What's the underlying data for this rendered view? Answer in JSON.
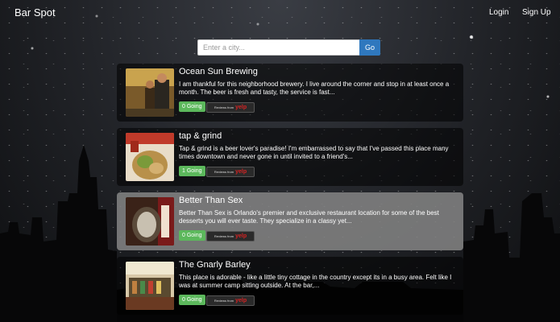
{
  "navbar": {
    "brand": "Bar Spot",
    "login": "Login",
    "signup": "Sign Up"
  },
  "search": {
    "placeholder": "Enter a city...",
    "button": "Go"
  },
  "results": [
    {
      "title": "Ocean Sun Brewing",
      "snippet": "I am thankful for this neighborhood brewery. I live around the corner and stop in at least once a month. The beer is fresh and tasty, the service is fast...",
      "going": "0 Going",
      "reviews_label": "Reviews from",
      "yelp": "yelp"
    },
    {
      "title": "tap & grind",
      "snippet": "Tap & grind is a beer lover's paradise! I'm embarrassed to say that I've passed this place many times downtown and never gone in until invited to a friend's...",
      "going": "1 Going",
      "reviews_label": "Reviews from",
      "yelp": "yelp"
    },
    {
      "title": "Better Than Sex",
      "snippet": "Better Than Sex is Orlando's premier and exclusive restaurant location for some of the best desserts you will ever taste. They specialize in a classy yet...",
      "going": "0 Going",
      "reviews_label": "Reviews from",
      "yelp": "yelp"
    },
    {
      "title": "The Gnarly Barley",
      "snippet": "This place is adorable - like a little tiny cottage in the country except its in a busy area. Felt like I was at summer camp sitting outside. At the bar,...",
      "going": "0 Going",
      "reviews_label": "Reviews from",
      "yelp": "yelp"
    }
  ],
  "colors": {
    "going_button": "#5cb85c",
    "search_button": "#2f78be",
    "yelp_red": "#d32323"
  }
}
